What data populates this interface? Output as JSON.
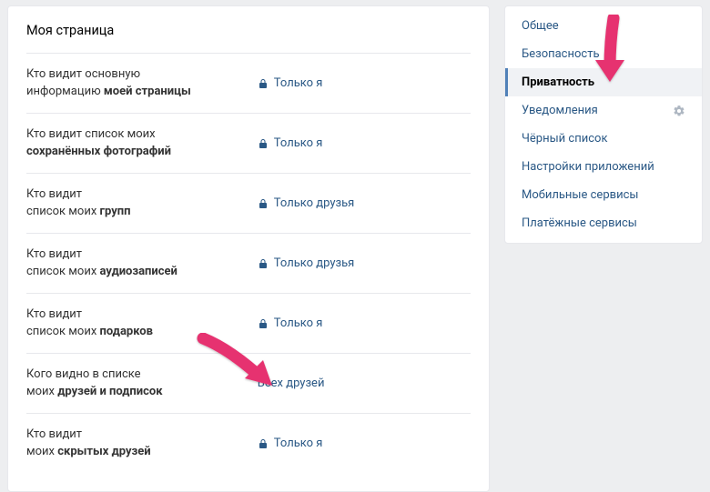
{
  "page": {
    "title": "Моя страница"
  },
  "settings": [
    {
      "label_pre": "Кто видит основную\nинформацию ",
      "label_bold": "моей страницы",
      "value": "Только я",
      "locked": true
    },
    {
      "label_pre": "Кто видит список моих\n",
      "label_bold": "сохранённых фотографий",
      "value": "Только я",
      "locked": true
    },
    {
      "label_pre": "Кто видит\nсписок моих ",
      "label_bold": "групп",
      "value": "Только друзья",
      "locked": true
    },
    {
      "label_pre": "Кто видит\nсписок моих ",
      "label_bold": "аудиозаписей",
      "value": "Только друзья",
      "locked": true
    },
    {
      "label_pre": "Кто видит\nсписок моих ",
      "label_bold": "подарков",
      "value": "Только я",
      "locked": true
    },
    {
      "label_pre": "Кого видно в списке\nмоих ",
      "label_bold": "друзей и подписок",
      "value": "Всех друзей",
      "locked": false
    },
    {
      "label_pre": "Кто видит\nмоих ",
      "label_bold": "скрытых друзей",
      "value": "Только я",
      "locked": true
    }
  ],
  "sidebar": {
    "items": [
      {
        "label": "Общее",
        "active": false,
        "gear": false
      },
      {
        "label": "Безопасность",
        "active": false,
        "gear": false
      },
      {
        "label": "Приватность",
        "active": true,
        "gear": false
      },
      {
        "label": "Уведомления",
        "active": false,
        "gear": true
      },
      {
        "label": "Чёрный список",
        "active": false,
        "gear": false
      },
      {
        "label": "Настройки приложений",
        "active": false,
        "gear": false
      },
      {
        "label": "Мобильные сервисы",
        "active": false,
        "gear": false
      },
      {
        "label": "Платёжные сервисы",
        "active": false,
        "gear": false
      }
    ]
  },
  "arrows": {
    "color": "#e6336f"
  }
}
